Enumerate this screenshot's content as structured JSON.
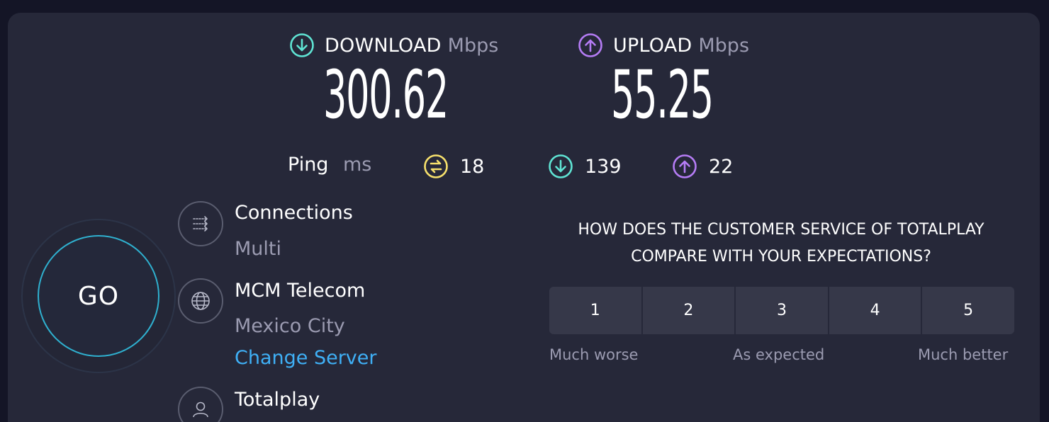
{
  "download": {
    "label": "DOWNLOAD",
    "unit": "Mbps",
    "value": "300.62",
    "icon": "arrow-down-circle-icon",
    "color": "#5fe3d3"
  },
  "upload": {
    "label": "UPLOAD",
    "unit": "Mbps",
    "value": "55.25",
    "icon": "arrow-up-circle-icon",
    "color": "#b57cf5"
  },
  "ping": {
    "label": "Ping",
    "unit": "ms",
    "idle": {
      "value": "18",
      "icon": "ping-exchange-icon",
      "color": "#f7e16c"
    },
    "download": {
      "value": "139",
      "icon": "arrow-down-circle-icon",
      "color": "#5fe3d3"
    },
    "upload": {
      "value": "22",
      "icon": "arrow-up-circle-icon",
      "color": "#b57cf5"
    }
  },
  "go_button": {
    "label": "GO"
  },
  "connections": {
    "title": "Connections",
    "value": "Multi",
    "icon": "connections-arrows-icon"
  },
  "server": {
    "title": "MCM Telecom",
    "location": "Mexico City",
    "change_label": "Change Server",
    "icon": "globe-icon"
  },
  "provider": {
    "title": "Totalplay",
    "icon": "user-icon"
  },
  "survey": {
    "question": "HOW DOES THE CUSTOMER SERVICE OF TOTALPLAY COMPARE WITH YOUR EXPECTATIONS?",
    "options": [
      "1",
      "2",
      "3",
      "4",
      "5"
    ],
    "low_label": "Much worse",
    "mid_label": "As expected",
    "high_label": "Much better"
  }
}
